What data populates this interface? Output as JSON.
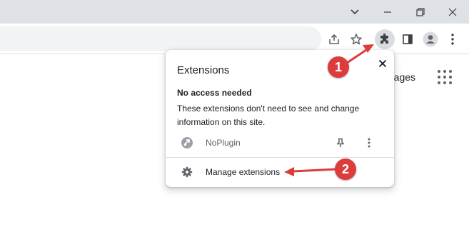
{
  "window_controls": {
    "chevron_icon": "chevron-down-icon",
    "minimize_icon": "minimize-icon",
    "restore_icon": "restore-icon",
    "close_icon": "close-icon"
  },
  "toolbar": {
    "share_icon": "share-icon",
    "bookmark_icon": "star-icon",
    "extensions_icon": "puzzle-icon",
    "side_panel_icon": "side-panel-icon",
    "profile_icon": "profile-icon",
    "menu_icon": "kebab-menu-icon"
  },
  "page": {
    "images_link": "mages",
    "apps_icon": "apps-grid-icon"
  },
  "extensions_popup": {
    "title": "Extensions",
    "section_heading": "No access needed",
    "section_description": "These extensions don't need to see and change information on this site.",
    "extensions": [
      {
        "name": "NoPlugin"
      }
    ],
    "manage_label": "Manage extensions"
  },
  "annotations": {
    "step1": "1",
    "step2": "2"
  },
  "colors": {
    "titlebar": "#dee1e6",
    "omnibox": "#f1f3f4",
    "callout": "#dd3c3c",
    "text": "#202124",
    "icon": "#5f6368"
  }
}
